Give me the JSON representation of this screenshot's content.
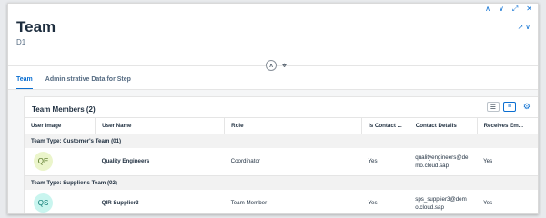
{
  "header": {
    "title": "Team",
    "subtitle": "D1"
  },
  "nav_icons": [
    "chevron-up-icon",
    "chevron-down-icon",
    "fullscreen-icon",
    "close-icon"
  ],
  "tabs": [
    {
      "label": "Team",
      "active": true
    },
    {
      "label": "Administrative Data for Step",
      "active": false
    }
  ],
  "card": {
    "title": "Team Members (2)"
  },
  "table": {
    "columns": [
      "User Image",
      "User Name",
      "Role",
      "Is Contact ...",
      "Contact Details",
      "Receives Em..."
    ],
    "groups": [
      {
        "label": "Team Type: Customer's Team (01)",
        "rows": [
          {
            "initials": "QE",
            "name": "Quality Engineers",
            "role": "Coordinator",
            "is_contact": "Yes",
            "contact": "qualityengineers@demo.cloud.sap",
            "receives": "Yes"
          }
        ]
      },
      {
        "label": "Team Type: Supplier's Team (02)",
        "rows": [
          {
            "initials": "QS",
            "name": "QIR Supplier3",
            "role": "Team Member",
            "is_contact": "Yes",
            "contact": "sps_supplier3@demo.cloud.sap",
            "receives": "Yes"
          }
        ]
      }
    ]
  },
  "colors": {
    "accent": "#0a6ed1",
    "avatar_green_bg": "#ebf5cb",
    "avatar_teal_bg": "#c9f5ef"
  }
}
